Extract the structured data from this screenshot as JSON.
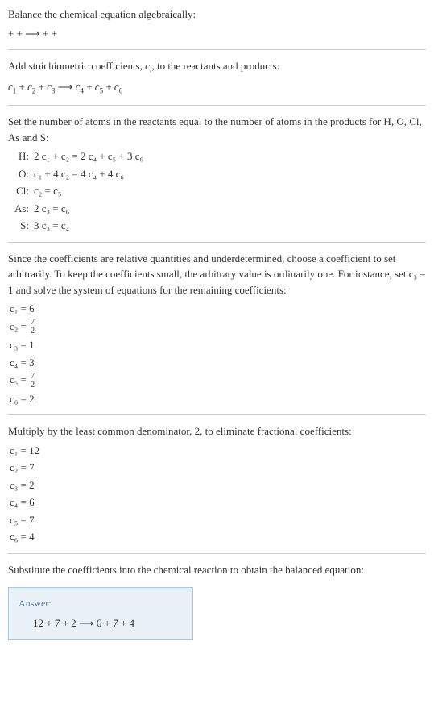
{
  "section1": {
    "line1": "Balance the chemical equation algebraically:",
    "line2": " +  +  ⟶  +  + "
  },
  "section2": {
    "line1": "Add stoichiometric coefficients, ",
    "ci": "c",
    "ci_sub": "i",
    "line1b": ", to the reactants and products:",
    "eq_parts": {
      "c1": "c",
      "s1": "1",
      "c2": "c",
      "s2": "2",
      "c3": "c",
      "s3": "3",
      "c4": "c",
      "s4": "4",
      "c5": "c",
      "s5": "5",
      "c6": "c",
      "s6": "6",
      "plus": " + ",
      "arrow": " ⟶ "
    }
  },
  "section3": {
    "line1": "Set the number of atoms in the reactants equal to the number of atoms in the products for H, O, Cl, As and S:",
    "rows": [
      {
        "label": "H:",
        "eq": "2 c₁ + c₂ = 2 c₄ + c₅ + 3 c₆"
      },
      {
        "label": "O:",
        "eq": "c₁ + 4 c₂ = 4 c₄ + 4 c₆"
      },
      {
        "label": "Cl:",
        "eq": "c₂ = c₅"
      },
      {
        "label": "As:",
        "eq": "2 c₃ = c₆"
      },
      {
        "label": "S:",
        "eq": "3 c₃ = c₄"
      }
    ]
  },
  "section4": {
    "line1": "Since the coefficients are relative quantities and underdetermined, choose a coefficient to set arbitrarily. To keep the coefficients small, the arbitrary value is ordinarily one. For instance, set c₃ = 1 and solve the system of equations for the remaining coefficients:",
    "coefs": [
      {
        "lhs": "c₁ = ",
        "val": "6",
        "frac": false
      },
      {
        "lhs": "c₂ = ",
        "num": "7",
        "den": "2",
        "frac": true
      },
      {
        "lhs": "c₃ = ",
        "val": "1",
        "frac": false
      },
      {
        "lhs": "c₄ = ",
        "val": "3",
        "frac": false
      },
      {
        "lhs": "c₅ = ",
        "num": "7",
        "den": "2",
        "frac": true
      },
      {
        "lhs": "c₆ = ",
        "val": "2",
        "frac": false
      }
    ]
  },
  "section5": {
    "line1": "Multiply by the least common denominator, 2, to eliminate fractional coefficients:",
    "coefs": [
      {
        "text": "c₁ = 12"
      },
      {
        "text": "c₂ = 7"
      },
      {
        "text": "c₃ = 2"
      },
      {
        "text": "c₄ = 6"
      },
      {
        "text": "c₅ = 7"
      },
      {
        "text": "c₆ = 4"
      }
    ]
  },
  "section6": {
    "line1": "Substitute the coefficients into the chemical reaction to obtain the balanced equation:",
    "answer_label": "Answer:",
    "answer_eq": "12  + 7  + 2  ⟶ 6  + 7  + 4 "
  }
}
